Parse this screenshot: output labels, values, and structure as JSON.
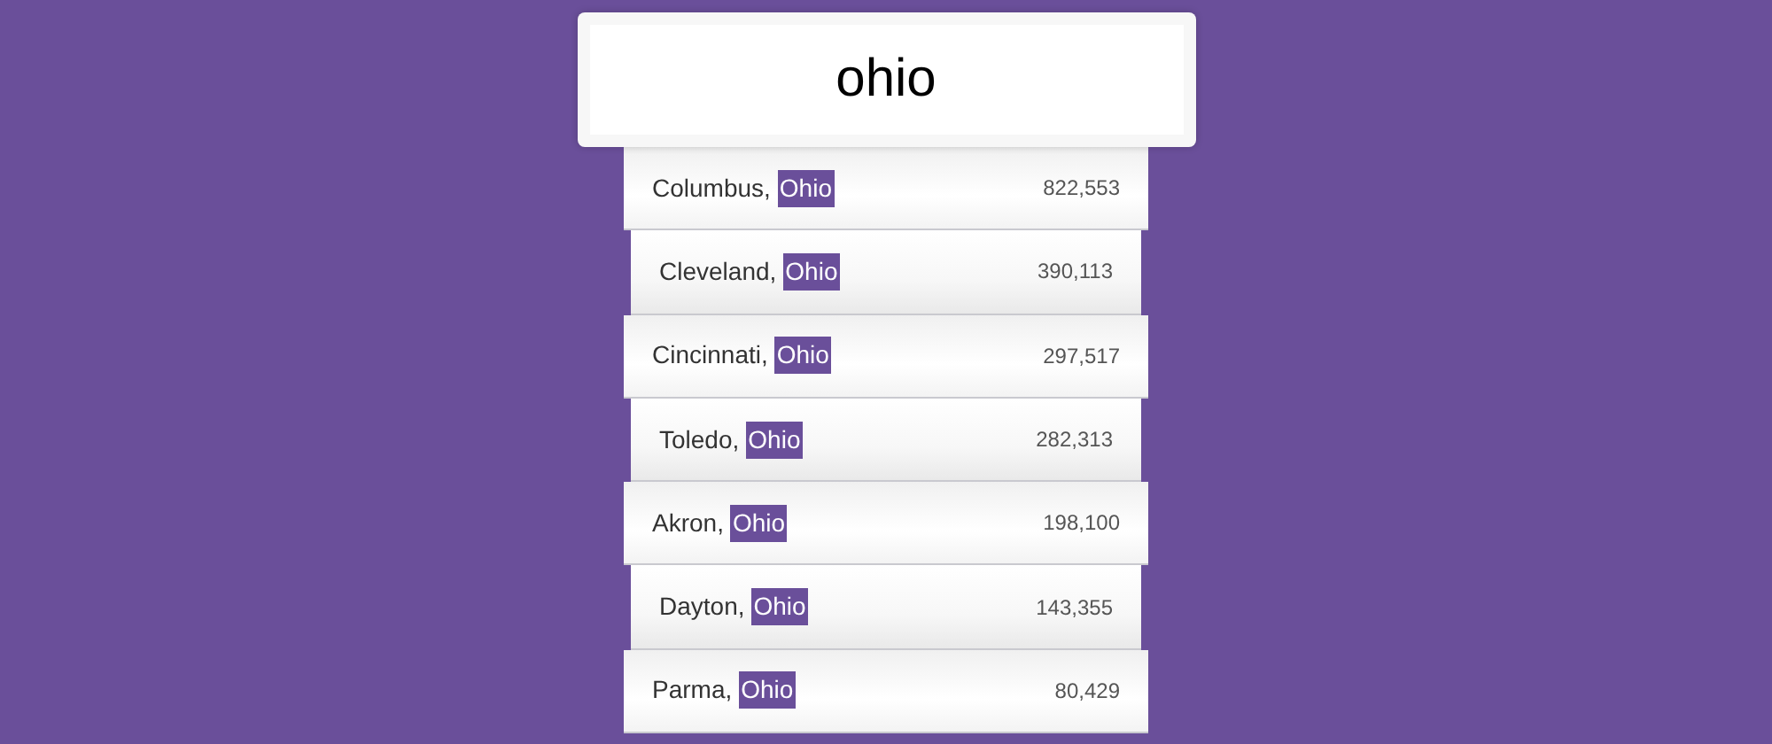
{
  "search": {
    "value": "ohio"
  },
  "suggestions": [
    {
      "city": "Columbus,",
      "match": "Ohio",
      "population": "822,553"
    },
    {
      "city": "Cleveland,",
      "match": "Ohio",
      "population": "390,113"
    },
    {
      "city": "Cincinnati,",
      "match": "Ohio",
      "population": "297,517"
    },
    {
      "city": "Toledo,",
      "match": "Ohio",
      "population": "282,313"
    },
    {
      "city": "Akron,",
      "match": "Ohio",
      "population": "198,100"
    },
    {
      "city": "Dayton,",
      "match": "Ohio",
      "population": "143,355"
    },
    {
      "city": "Parma,",
      "match": "Ohio",
      "population": "80,429"
    }
  ]
}
